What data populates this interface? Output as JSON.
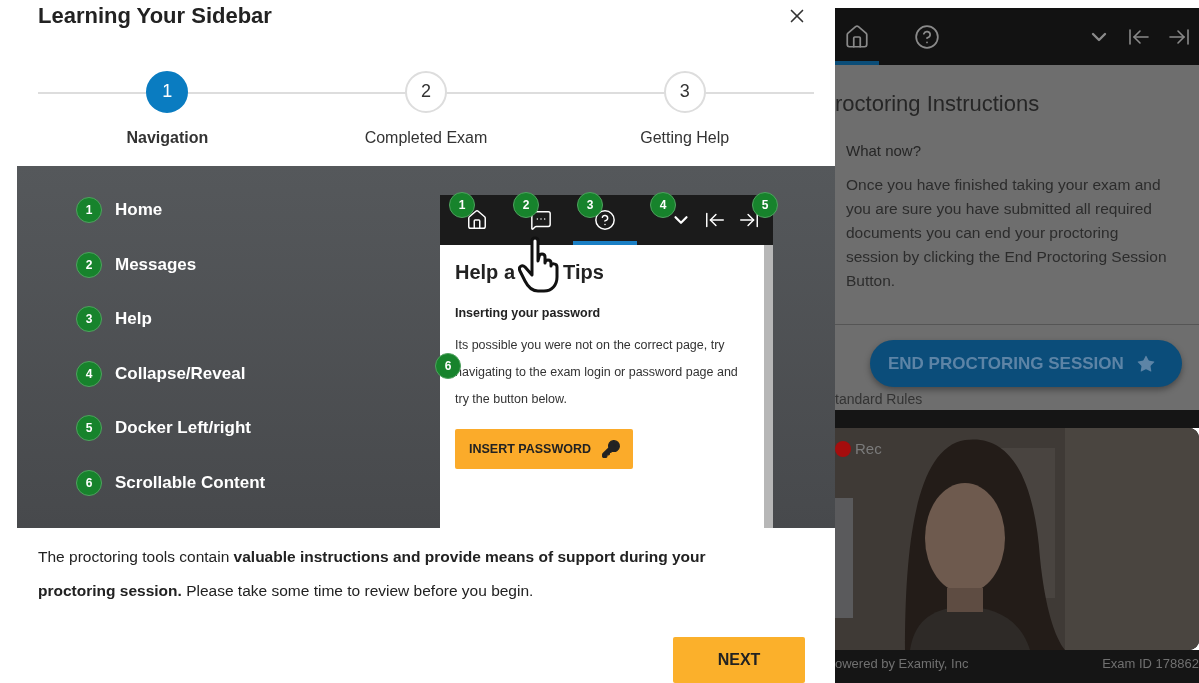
{
  "modal": {
    "title": "Learning Your Sidebar",
    "steps": [
      {
        "number": "1",
        "label": "Navigation",
        "selected": true
      },
      {
        "number": "2",
        "label": "Completed Exam",
        "selected": false
      },
      {
        "number": "3",
        "label": "Getting Help",
        "selected": false
      }
    ],
    "legend": [
      {
        "number": "1",
        "label": "Home"
      },
      {
        "number": "2",
        "label": "Messages"
      },
      {
        "number": "3",
        "label": "Help"
      },
      {
        "number": "4",
        "label": "Collapse/Reveal"
      },
      {
        "number": "5",
        "label": "Docker Left/right"
      },
      {
        "number": "6",
        "label": "Scrollable Content"
      }
    ],
    "preview": {
      "tabs": [
        {
          "kind": "home",
          "badge": "1",
          "selected": false
        },
        {
          "kind": "messages",
          "badge": "2",
          "selected": false
        },
        {
          "kind": "help",
          "badge": "3",
          "selected": true
        }
      ],
      "controls": [
        {
          "kind": "collapse",
          "badge": "4"
        },
        {
          "kind": "dock-left"
        },
        {
          "kind": "dock-right",
          "badge": "5"
        }
      ],
      "title_parts": [
        "Help a",
        "Tips"
      ],
      "subtitle": "Inserting your password",
      "body_badge": "6",
      "body": "Its possible you were not on the correct page, try navigating to the exam login or password page and try the button below.",
      "button": "INSERT PASSWORD"
    },
    "description": "The proctoring tools contain **valuable instructions and provide means of support during your proctoring session.** Please take some time to review before you begin.",
    "next_button": "NEXT"
  },
  "sidebar": {
    "tabs": [
      {
        "kind": "home",
        "selected": true
      },
      {
        "kind": "help",
        "selected": false
      }
    ],
    "controls": [
      {
        "kind": "collapse"
      },
      {
        "kind": "dock-left"
      },
      {
        "kind": "dock-right"
      }
    ],
    "heading": "roctoring Instructions",
    "section_title": "What now?",
    "body": "Once you have finished taking your exam and you are sure you have submitted all required documents you can end your proctoring session by clicking the End Proctoring Session Button.",
    "end_button": "END PROCTORING SESSION",
    "faded_heading": "tandard Rules",
    "video": {
      "kind": "picture",
      "rec_label": "Rec"
    },
    "footer_left": "owered by Examity, Inc",
    "footer_right": "Exam ID 178862"
  }
}
